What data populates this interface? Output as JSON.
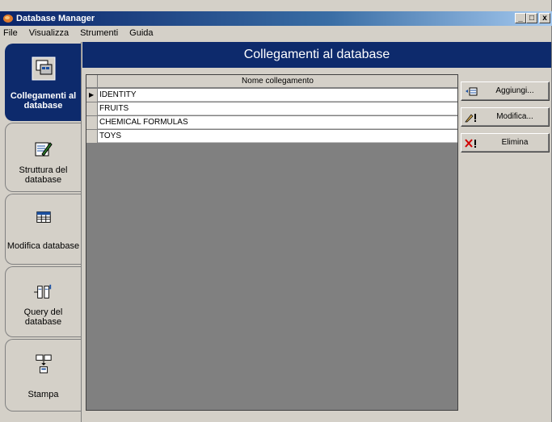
{
  "window": {
    "title": "Database Manager"
  },
  "window_buttons": {
    "minimize": "_",
    "maximize": "□",
    "close": "x"
  },
  "menu": [
    {
      "label": "File"
    },
    {
      "label": "Visualizza"
    },
    {
      "label": "Strumenti"
    },
    {
      "label": "Guida"
    }
  ],
  "nav": [
    {
      "label": "Collegamenti al database",
      "icon": "database-link-icon",
      "active": true
    },
    {
      "label": "Struttura del database",
      "icon": "database-structure-icon",
      "active": false
    },
    {
      "label": "Modifica database",
      "icon": "table-edit-icon",
      "active": false
    },
    {
      "label": "Query del database",
      "icon": "query-icon",
      "active": false
    },
    {
      "label": "Stampa",
      "icon": "print-icon",
      "active": false
    }
  ],
  "header": {
    "title": "Collegamenti al database"
  },
  "grid": {
    "column_header": "Nome collegamento",
    "rows": [
      "IDENTITY",
      "FRUITS",
      "CHEMICAL FORMULAS",
      "TOYS"
    ],
    "selected_row_indicator": "▶"
  },
  "actions": {
    "add": {
      "label": "Aggiungi...",
      "icon": "add-icon"
    },
    "edit": {
      "label": "Modifica...",
      "icon": "edit-icon"
    },
    "delete": {
      "label": "Elimina",
      "icon": "delete-icon"
    }
  },
  "colors": {
    "accent": "#0d2a6c",
    "grid_background": "#808080",
    "window_background": "#d4d0c8"
  }
}
